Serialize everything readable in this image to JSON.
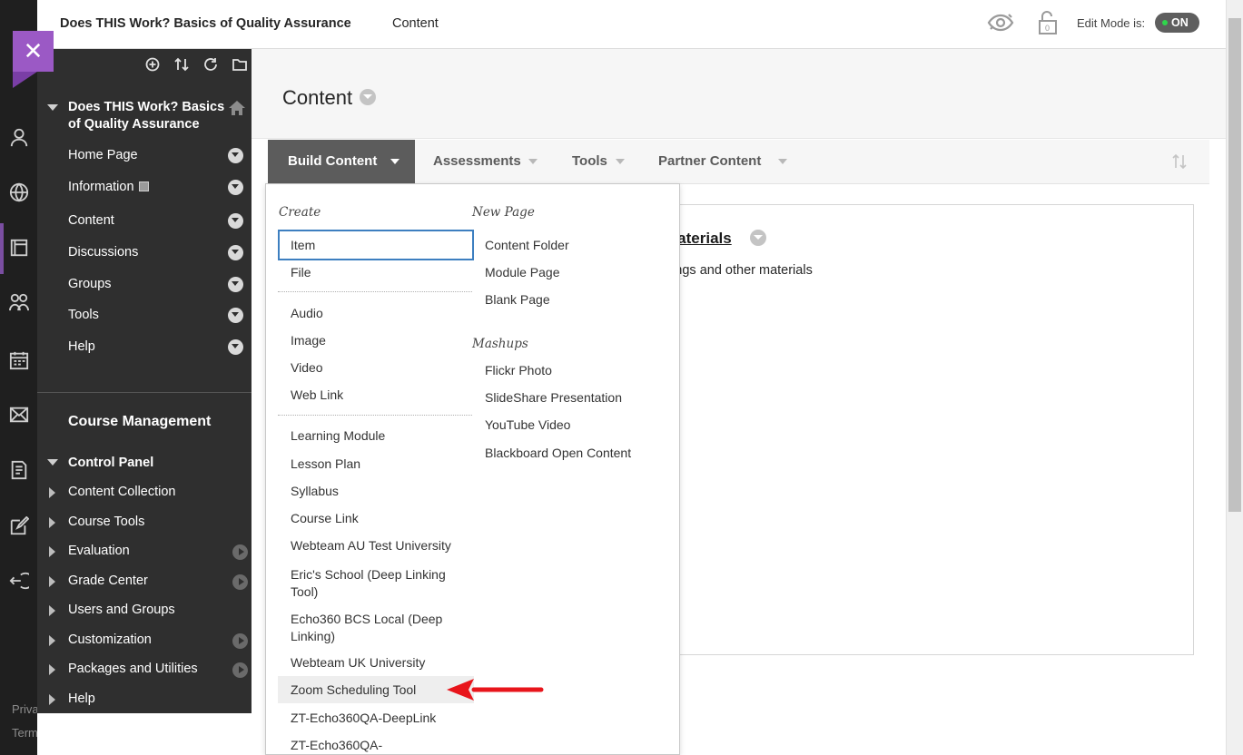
{
  "header": {
    "course_title": "Does THIS Work? Basics of Quality Assurance",
    "page_name": "Content",
    "edit_mode_label": "Edit Mode is:",
    "edit_mode_value": "ON"
  },
  "rail": {
    "icons": [
      "user-icon",
      "globe-icon",
      "courses-icon",
      "groups-icon",
      "calendar-icon",
      "mail-icon",
      "grades-icon",
      "edit-icon",
      "sign-out-icon"
    ],
    "footer_1": "Priva",
    "footer_2": "Term"
  },
  "course_menu": {
    "title": "Does THIS Work? Basics of Quality Assurance",
    "items": [
      {
        "label": "Home Page"
      },
      {
        "label": "Information"
      },
      {
        "label": "Content"
      },
      {
        "label": "Discussions"
      },
      {
        "label": "Groups"
      },
      {
        "label": "Tools"
      },
      {
        "label": "Help"
      }
    ],
    "management_title": "Course Management",
    "control_panel": "Control Panel",
    "cp_items": [
      {
        "label": "Content Collection"
      },
      {
        "label": "Course Tools"
      },
      {
        "label": "Evaluation"
      },
      {
        "label": "Grade Center"
      },
      {
        "label": "Users and Groups"
      },
      {
        "label": "Customization"
      },
      {
        "label": "Packages and Utilities"
      },
      {
        "label": "Help"
      }
    ]
  },
  "content": {
    "title": "Content",
    "action_bar": {
      "build": "Build Content",
      "assessments": "Assessments",
      "tools": "Tools",
      "partner": "Partner Content"
    },
    "item_title": "Materials",
    "item_desc": "dings and other materials"
  },
  "dropdown": {
    "create_header": "Create",
    "create_group1": [
      "Item",
      "File"
    ],
    "create_group2": [
      "Audio",
      "Image",
      "Video",
      "Web Link"
    ],
    "create_group3": [
      "Learning Module",
      "Lesson Plan",
      "Syllabus",
      "Course Link",
      "Webteam AU Test University",
      "Eric's School (Deep Linking Tool)",
      "Echo360 BCS Local (Deep Linking)",
      "Webteam UK University",
      "Zoom Scheduling Tool",
      "ZT-Echo360QA-DeepLink",
      "ZT-Echo360QA-"
    ],
    "newpage_header": "New Page",
    "newpage_items": [
      "Content Folder",
      "Module Page",
      "Blank Page"
    ],
    "mashups_header": "Mashups",
    "mashups_items": [
      "Flickr Photo",
      "SlideShare Presentation",
      "YouTube Video",
      "Blackboard Open Content"
    ]
  },
  "colors": {
    "menu_bg": "#2f2f2f",
    "rail_bg": "#1f1f1f",
    "accent_purple": "#9b59c5",
    "action_active": "#5c5c5c",
    "focus_blue": "#3d7fc0",
    "annotation_red": "#e8151b",
    "toggle_dot": "#2fd64c"
  }
}
